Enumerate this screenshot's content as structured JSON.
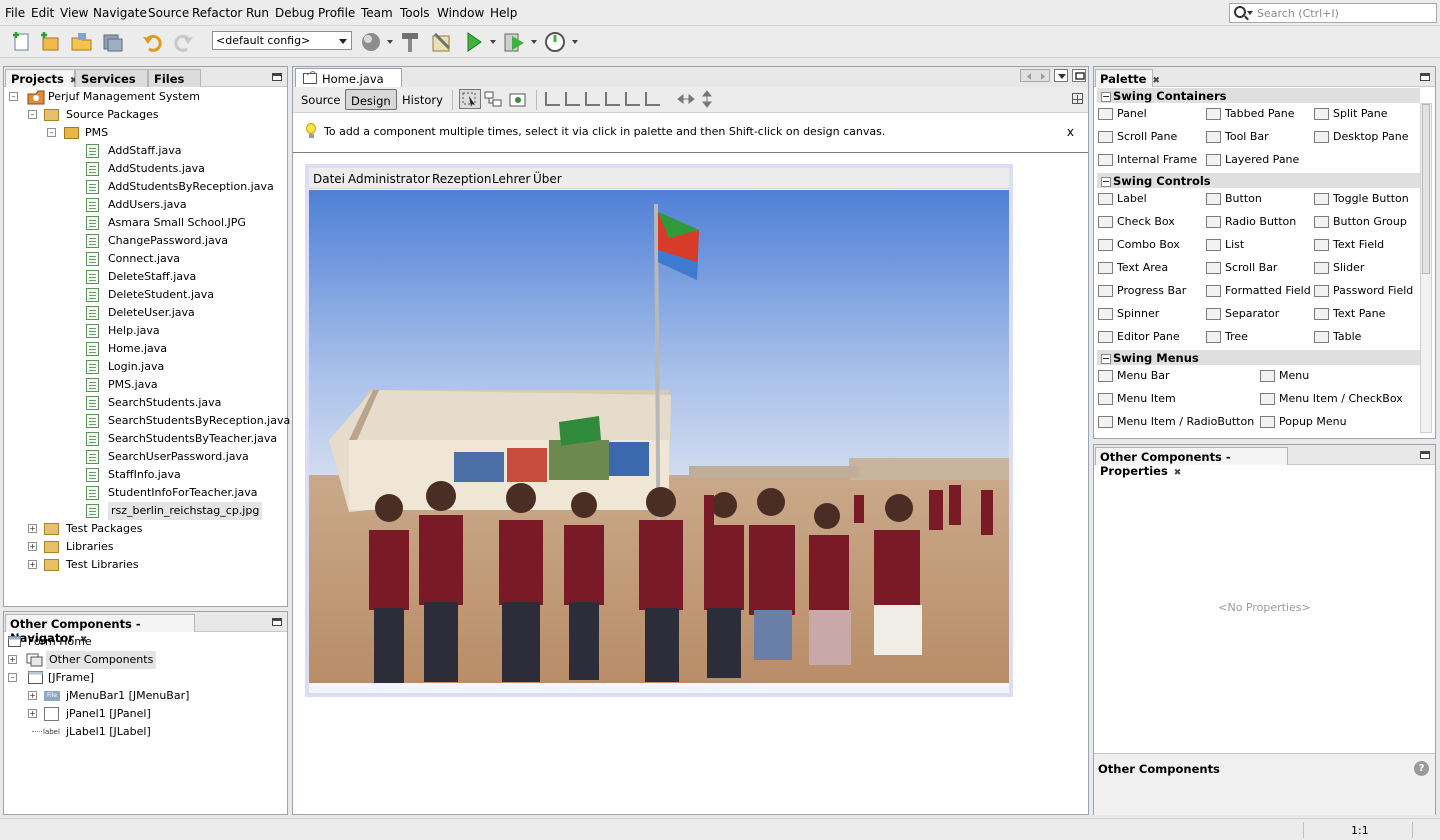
{
  "menubar": {
    "items": [
      "File",
      "Edit",
      "View",
      "Navigate",
      "Source",
      "Refactor",
      "Run",
      "Debug",
      "Profile",
      "Team",
      "Tools",
      "Window",
      "Help"
    ],
    "search_placeholder": "Search (Ctrl+I)"
  },
  "toolbar": {
    "config_value": "<default config>"
  },
  "projects": {
    "tabs": [
      "Projects",
      "Services",
      "Files"
    ],
    "root": "Perjuf Management System",
    "source_packages": "Source Packages",
    "package": "PMS",
    "files": [
      "AddStaff.java",
      "AddStudents.java",
      "AddStudentsByReception.java",
      "AddUsers.java",
      "Asmara Small School.JPG",
      "ChangePassword.java",
      "Connect.java",
      "DeleteStaff.java",
      "DeleteStudent.java",
      "DeleteUser.java",
      "Help.java",
      "Home.java",
      "Login.java",
      "PMS.java",
      "SearchStudents.java",
      "SearchStudentsByReception.java",
      "SearchStudentsByTeacher.java",
      "SearchUserPassword.java",
      "StaffInfo.java",
      "StudentInfoForTeacher.java",
      "rsz_berlin_reichstag_cp.jpg"
    ],
    "other_nodes": [
      "Test Packages",
      "Libraries",
      "Test Libraries"
    ]
  },
  "navigator": {
    "title": "Other Components - Navigator",
    "form": "Form Home",
    "other_components": "Other Components",
    "jframe": "[JFrame]",
    "children": [
      "jMenuBar1 [JMenuBar]",
      "jPanel1 [JPanel]",
      "jLabel1 [JLabel]"
    ]
  },
  "editor": {
    "tab_title": "Home.java",
    "views": [
      "Source",
      "Design",
      "History"
    ],
    "hint": "To add a component multiple times, select it via click in palette and then Shift-click on design canvas.",
    "hint_close": "x",
    "form_menu": [
      "Datei",
      "Administrator",
      "Rezeption",
      "Lehrer",
      "Über"
    ]
  },
  "palette": {
    "title": "Palette",
    "categories": [
      {
        "name": "Swing Containers",
        "items": [
          "Panel",
          "Tabbed Pane",
          "Split Pane",
          "Scroll Pane",
          "Tool Bar",
          "Desktop Pane",
          "Internal Frame",
          "Layered Pane"
        ]
      },
      {
        "name": "Swing Controls",
        "items": [
          "Label",
          "Button",
          "Toggle Button",
          "Check Box",
          "Radio Button",
          "Button Group",
          "Combo Box",
          "List",
          "Text Field",
          "Text Area",
          "Scroll Bar",
          "Slider",
          "Progress Bar",
          "Formatted Field",
          "Password Field",
          "Spinner",
          "Separator",
          "Text Pane",
          "Editor Pane",
          "Tree",
          "Table"
        ]
      },
      {
        "name": "Swing Menus",
        "items": [
          "Menu Bar",
          "Menu",
          "Menu Item",
          "Menu Item / CheckBox",
          "Menu Item / RadioButton",
          "Popup Menu"
        ]
      }
    ]
  },
  "properties": {
    "title": "Other Components - Properties",
    "empty": "<No Properties>",
    "footer_title": "Other Components"
  },
  "status": {
    "position": "1:1"
  },
  "colors": {
    "panel_border": "#9aa4b0",
    "tab_bg": "#e8e8e8",
    "canvas_frame": "#dcdcf5"
  }
}
